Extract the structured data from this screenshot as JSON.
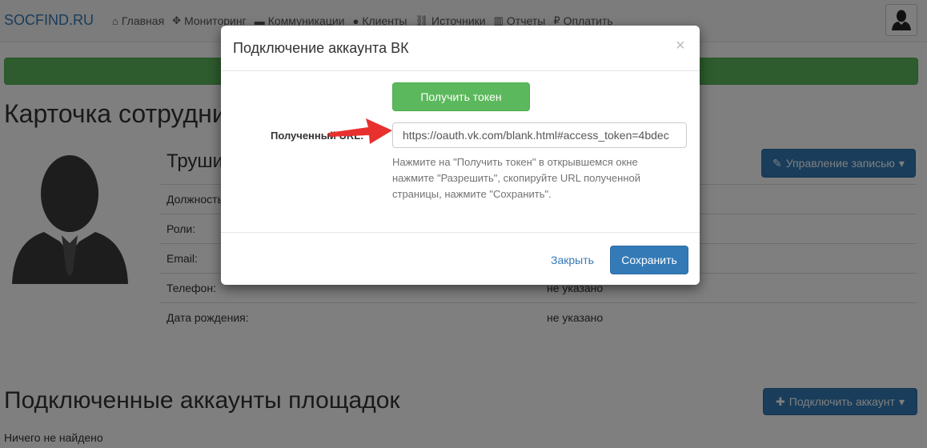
{
  "navbar": {
    "brand": "SOCFIND.RU",
    "items": [
      {
        "label": "Главная",
        "icon": "home-icon",
        "glyph": "⌂"
      },
      {
        "label": "Мониторинг",
        "icon": "move-icon",
        "glyph": "✥"
      },
      {
        "label": "Коммуникации",
        "icon": "comment-icon",
        "glyph": "▬"
      },
      {
        "label": "Клиенты",
        "icon": "user-icon",
        "glyph": "●"
      },
      {
        "label": "Источники",
        "icon": "link-icon",
        "glyph": "⛓"
      },
      {
        "label": "Отчеты",
        "icon": "chart-icon",
        "glyph": "▥"
      },
      {
        "label": "Оплатить",
        "icon": "ruble-icon",
        "glyph": "₽"
      }
    ]
  },
  "page": {
    "title": "Карточка сотрудника",
    "person_name": "Трушин",
    "manage_button": "Управление записью",
    "info_rows": [
      {
        "label": "Должность:",
        "value": ""
      },
      {
        "label": "Роли:",
        "value": ""
      },
      {
        "label": "Email:",
        "value": ""
      },
      {
        "label": "Телефон:",
        "value": "не указано"
      },
      {
        "label": "Дата рождения:",
        "value": "не указано"
      }
    ],
    "accounts_title": "Подключенные аккаунты площадок",
    "connect_button": "Подключить аккаунт",
    "empty_text": "Ничего не найдено"
  },
  "modal": {
    "title": "Подключение аккаунта ВК",
    "close_symbol": "×",
    "get_token_button": "Получить токен",
    "url_label": "Полученный URL:",
    "url_value": "https://oauth.vk.com/blank.html#access_token=4bdec",
    "help_text": "Нажмите на \"Получить токен\" в открывшемся окне нажмите \"Разрешить\", скопируйте URL полученной страницы, нажмите \"Сохранить\".",
    "close_button": "Закрыть",
    "save_button": "Сохранить"
  },
  "colors": {
    "primary": "#337ab7",
    "success": "#5cb85c",
    "arrow": "#e8302e"
  }
}
